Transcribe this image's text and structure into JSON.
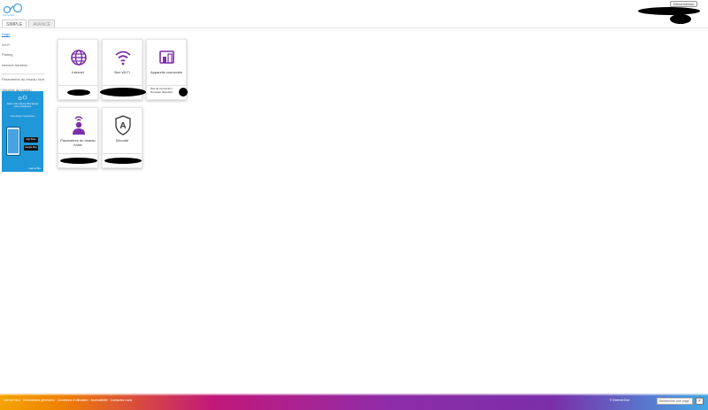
{
  "header": {
    "logo_subtext": "Internet Box",
    "tabs": [
      {
        "label": "SIMPLE",
        "active": true
      },
      {
        "label": "AVANCÉ",
        "active": false
      }
    ],
    "logout_label": "Déconnexion"
  },
  "sidebar": {
    "items": [
      {
        "label": "Page",
        "active": true
      },
      {
        "label": "Wi-Fi"
      },
      {
        "label": "Pairing"
      },
      {
        "label": "Internet Address"
      },
      {
        "label": "Paramètres du réseau invité"
      },
      {
        "label": "Sécurité du réseau"
      }
    ],
    "promo": {
      "line1": "Gérez votre Internet Box depuis votre smartphone",
      "line2": "Téléchargez l'application",
      "store1": "App Store",
      "store2": "Google Play",
      "footer": "Internet Box"
    }
  },
  "tiles": [
    {
      "icon": "globe-icon",
      "label": "Internet",
      "note": ""
    },
    {
      "icon": "wifi-icon",
      "label": "Box Wi-Fi",
      "note": ""
    },
    {
      "icon": "devices-icon",
      "label": "Appareils connectés",
      "note": "Pas de connexion / Nouveau dispositif"
    },
    {
      "icon": "guest-network-icon",
      "label": "Paramètres du réseau invité",
      "note": ""
    },
    {
      "icon": "security-icon",
      "label": "Sécurité",
      "note": ""
    }
  ],
  "footer": {
    "links": "Internet Box · Informations générales · Conditions d'utilisation · Accessibilité · Contactez-nous",
    "right_text": "© Internet Box",
    "search_value": "Rechercher une page",
    "close_label": "×"
  },
  "colors": {
    "accent_purple": "#7b2fa8",
    "brand_blue": "#4aa3df",
    "promo_blue": "#1f97d8"
  }
}
